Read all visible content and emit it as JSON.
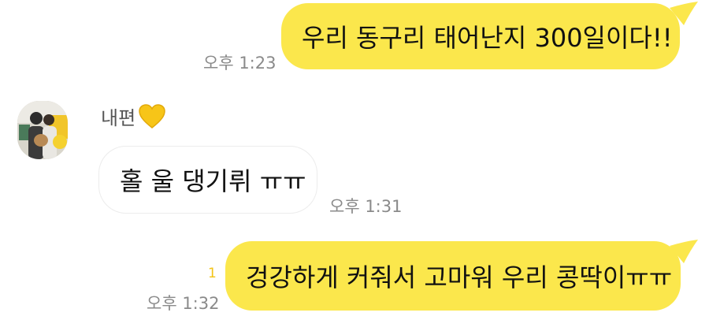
{
  "colors": {
    "my_bubble": "#fbe74c",
    "other_bubble": "#ffffff",
    "time_text": "#8a8a8a",
    "unread": "#f3c315"
  },
  "messages": [
    {
      "sender": "me",
      "text": "우리 동구리 태어난지 300일이다!!",
      "time": "오후 1:23"
    },
    {
      "sender": "other",
      "sender_name": "내편",
      "name_icon": "yellow-heart-icon",
      "text": "홀 울 댕기뤼 ㅠㅠ",
      "time": "오후 1:31"
    },
    {
      "sender": "me",
      "text": "겅강하게 커줘서 고마워 우리 콩딱이ㅠㅠ",
      "time": "오후 1:32",
      "unread_count": "1"
    }
  ]
}
